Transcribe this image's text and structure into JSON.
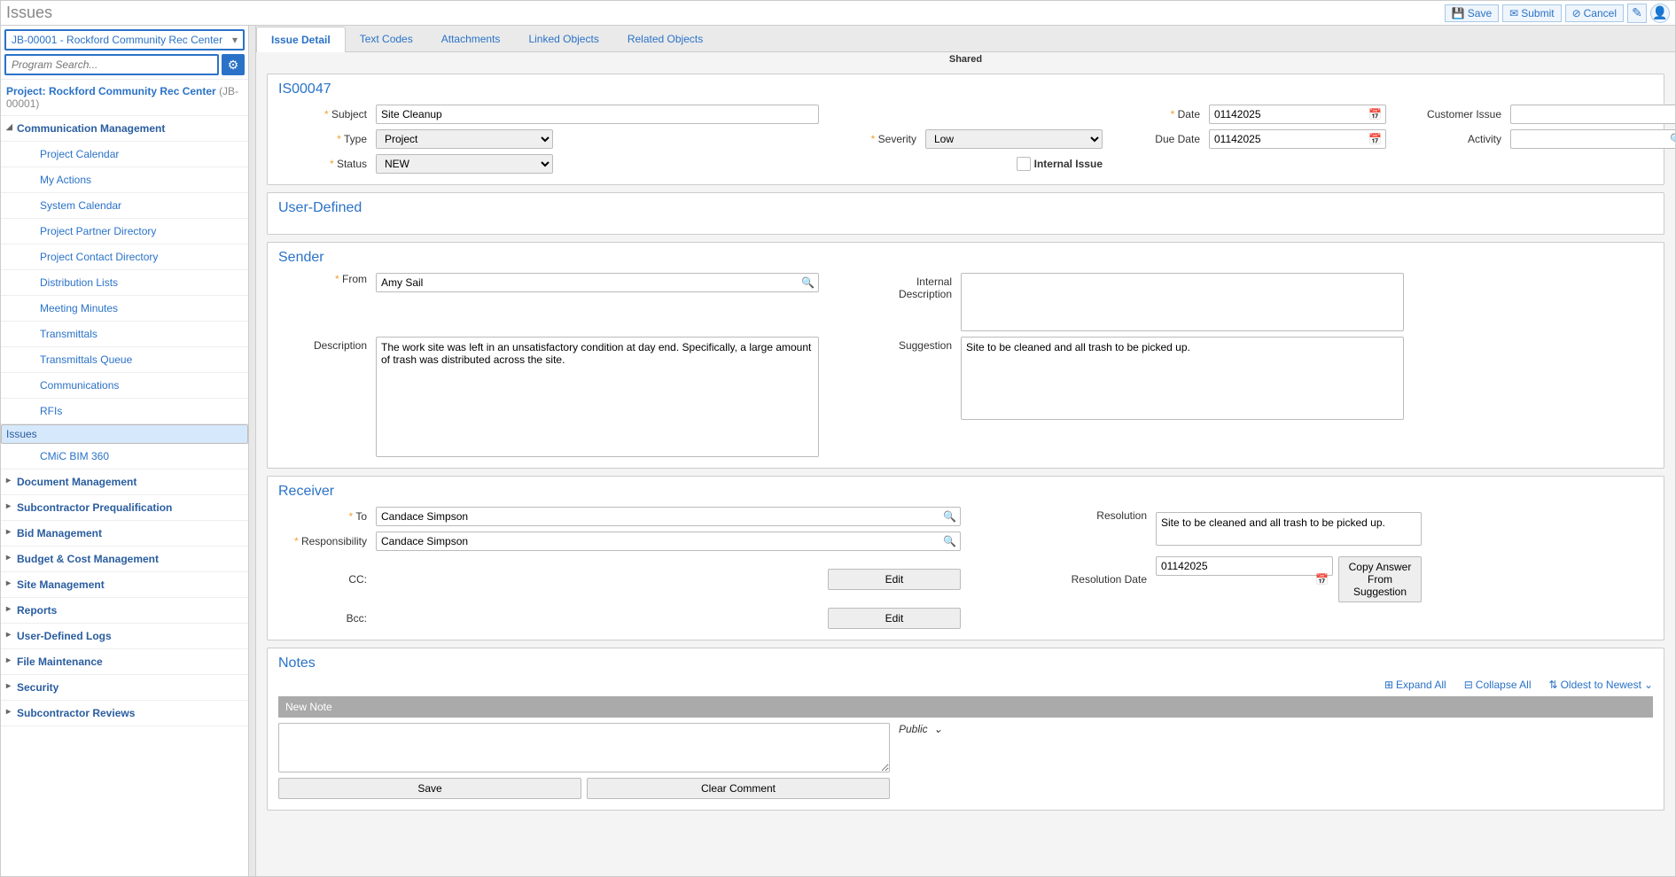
{
  "titlebar": {
    "title": "Issues",
    "save": "Save",
    "submit": "Submit",
    "cancel": "Cancel"
  },
  "sidebar": {
    "project_select": "JB-00001 - Rockford Community Rec Center",
    "search_placeholder": "Program Search...",
    "project_header_label": "Project: Rockford Community Rec Center",
    "project_header_code": "(JB-00001)",
    "sections": [
      {
        "label": "Communication Management",
        "expanded": true,
        "children": [
          "Project Calendar",
          "My Actions",
          "System Calendar",
          "Project Partner Directory",
          "Project Contact Directory",
          "Distribution Lists",
          "Meeting Minutes",
          "Transmittals",
          "Transmittals Queue",
          "Communications",
          "RFIs",
          "Issues",
          "CMiC BIM 360"
        ],
        "selected": "Issues"
      },
      {
        "label": "Document Management"
      },
      {
        "label": "Subcontractor Prequalification"
      },
      {
        "label": "Bid Management"
      },
      {
        "label": "Budget & Cost Management"
      },
      {
        "label": "Site Management"
      },
      {
        "label": "Reports"
      },
      {
        "label": "User-Defined Logs"
      },
      {
        "label": "File Maintenance"
      },
      {
        "label": "Security"
      },
      {
        "label": "Subcontractor Reviews"
      }
    ]
  },
  "tabs": [
    "Issue Detail",
    "Text Codes",
    "Attachments",
    "Linked Objects",
    "Related Objects"
  ],
  "active_tab": "Issue Detail",
  "shared_label": "Shared",
  "issue": {
    "id": "IS00047",
    "subject_lbl": "Subject",
    "subject": "Site Cleanup",
    "type_lbl": "Type",
    "type": "Project",
    "status_lbl": "Status",
    "status": "NEW",
    "severity_lbl": "Severity",
    "severity": "Low",
    "internal_issue_lbl": "Internal Issue",
    "date_lbl": "Date",
    "date": "01142025",
    "due_date_lbl": "Due Date",
    "due_date": "01142025",
    "customer_issue_lbl": "Customer Issue",
    "customer_issue": "",
    "activity_lbl": "Activity",
    "activity": ""
  },
  "userdef": {
    "title": "User-Defined"
  },
  "sender": {
    "title": "Sender",
    "from_lbl": "From",
    "from": "Amy Sail",
    "desc_lbl": "Description",
    "desc": "The work site was left in an unsatisfactory condition at day end. Specifically, a large amount of trash was distributed across the site.",
    "internal_desc_lbl": "Internal Description",
    "internal_desc": "",
    "suggestion_lbl": "Suggestion",
    "suggestion": "Site to be cleaned and all trash to be picked up."
  },
  "receiver": {
    "title": "Receiver",
    "to_lbl": "To",
    "to": "Candace Simpson",
    "resp_lbl": "Responsibility",
    "resp": "Candace Simpson",
    "cc_lbl": "CC:",
    "bcc_lbl": "Bcc:",
    "edit": "Edit",
    "resolution_lbl": "Resolution",
    "resolution": "Site to be cleaned and all trash to be picked up.",
    "res_date_lbl": "Resolution Date",
    "res_date": "01142025",
    "copy_btn": "Copy Answer From Suggestion"
  },
  "notes": {
    "title": "Notes",
    "expand": "Expand All",
    "collapse": "Collapse All",
    "sort": "Oldest to Newest",
    "new_hdr": "New Note",
    "visibility": "Public",
    "save": "Save",
    "clear": "Clear Comment"
  }
}
